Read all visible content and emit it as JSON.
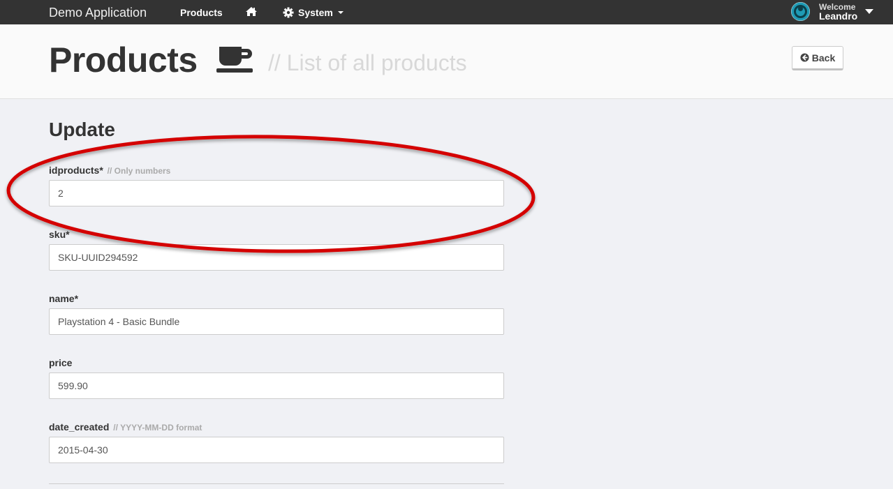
{
  "navbar": {
    "brand": "Demo Application",
    "products": "Products",
    "system": "System",
    "welcome": "Welcome",
    "username": "Leandro"
  },
  "header": {
    "title": "Products",
    "subtitle": "// List of all products",
    "back_label": "Back"
  },
  "form": {
    "section_title": "Update",
    "fields": [
      {
        "label": "idproducts*",
        "hint": "// Only numbers",
        "value": "2"
      },
      {
        "label": "sku*",
        "hint": "",
        "value": "SKU-UUID294592"
      },
      {
        "label": "name*",
        "hint": "",
        "value": "Playstation 4 - Basic Bundle"
      },
      {
        "label": "price",
        "hint": "",
        "value": "599.90"
      },
      {
        "label": "date_created",
        "hint": "// YYYY-MM-DD format",
        "value": "2015-04-30"
      }
    ]
  },
  "icons": {
    "home": "home-icon",
    "system": "gear-icon",
    "title": "coffee-cup-icon",
    "back": "arrow-circle-left-icon"
  },
  "colors": {
    "navbar_bg": "#333333",
    "page_bg": "#f0f1f5",
    "annotation": "#e00000"
  }
}
